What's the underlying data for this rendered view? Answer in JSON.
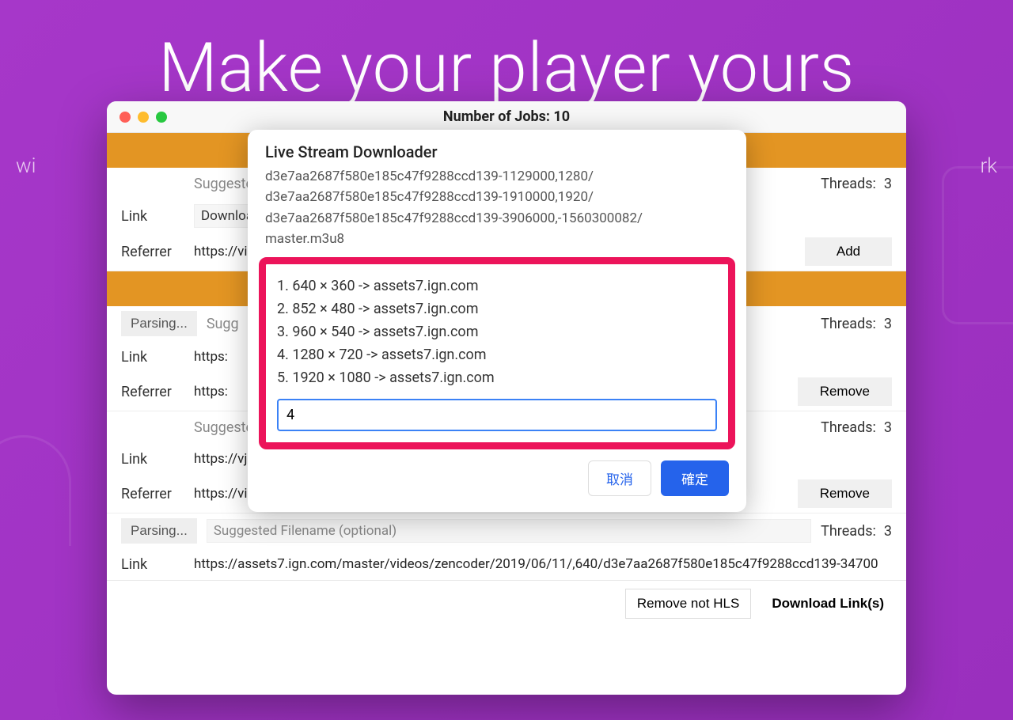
{
  "background": {
    "title": "Make your player yours",
    "subtitle_left": "wi",
    "subtitle_right": "rk"
  },
  "window": {
    "title": "Number of Jobs: 10",
    "footer": {
      "remove_not_hls": "Remove not HLS",
      "download_links": "Download Link(s)"
    }
  },
  "jobs": [
    {
      "suggested_label": "Suggested",
      "threads_label": "Threads:",
      "threads_value": "3",
      "link_label": "Link",
      "link_value": "Download",
      "referrer_label": "Referrer",
      "referrer_value": "https://vid",
      "action_label": "Add"
    },
    {
      "parsing_label": "Parsing...",
      "suggested_label": "Sugg",
      "threads_label": "Threads:",
      "threads_value": "3",
      "link_label": "Link",
      "link_value": "https:",
      "referrer_label": "Referrer",
      "referrer_value": "https:",
      "action_label": "Remove"
    },
    {
      "suggested_label": "Suggested",
      "threads_label": "Threads:",
      "threads_value": "3",
      "link_label": "Link",
      "link_value": "https://vjs.",
      "referrer_label": "Referrer",
      "referrer_value": "https://videojs.com/",
      "action_label": "Remove"
    },
    {
      "parsing_label": "Parsing...",
      "suggested_placeholder": "Suggested Filename (optional)",
      "threads_label": "Threads:",
      "threads_value": "3",
      "link_label": "Link",
      "link_value": "https://assets7.ign.com/master/videos/zencoder/2019/06/11/,640/d3e7aa2687f580e185c47f9288ccd139-34700"
    }
  ],
  "modal": {
    "title": "Live Stream Downloader",
    "desc_lines": [
      "d3e7aa2687f580e185c47f9288ccd139-1129000,1280/",
      "d3e7aa2687f580e185c47f9288ccd139-1910000,1920/",
      "d3e7aa2687f580e185c47f9288ccd139-3906000,-1560300082/",
      "master.m3u8"
    ],
    "quality_options": [
      "1. 640 × 360 -> assets7.ign.com",
      "2. 852 × 480 -> assets7.ign.com",
      "3. 960 × 540 -> assets7.ign.com",
      "4. 1280 × 720 -> assets7.ign.com",
      "5. 1920 × 1080 -> assets7.ign.com"
    ],
    "input_value": "4",
    "cancel_label": "取消",
    "confirm_label": "確定"
  }
}
